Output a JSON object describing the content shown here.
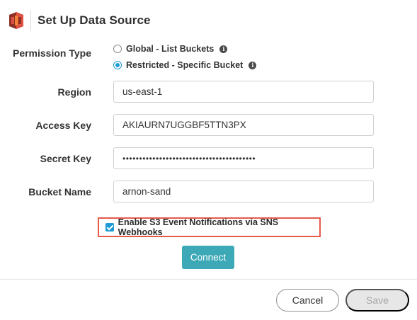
{
  "header": {
    "title": "Set Up Data Source",
    "logo_icon": "aws-s3-bucket-icon",
    "logo_colors": [
      "#e05243",
      "#8c3123"
    ]
  },
  "permission": {
    "label": "Permission Type",
    "options": [
      {
        "label": "Global - List Buckets",
        "selected": false
      },
      {
        "label": "Restricted - Specific Bucket",
        "selected": true
      }
    ],
    "info_icon": "info-icon"
  },
  "fields": {
    "region": {
      "label": "Region",
      "value": "us-east-1"
    },
    "access_key": {
      "label": "Access Key",
      "value": "AKIAURN7UGGBF5TTN3PX"
    },
    "secret_key": {
      "label": "Secret Key",
      "value": "••••••••••••••••••••••••••••••••••••••••"
    },
    "bucket_name": {
      "label": "Bucket Name",
      "value": "arnon-sand"
    }
  },
  "notifications": {
    "label": "Enable S3 Event Notifications via SNS Webhooks",
    "checked": true,
    "highlight_color": "#e55a4a"
  },
  "actions": {
    "connect_label": "Connect",
    "cancel_label": "Cancel",
    "save_label": "Save"
  },
  "colors": {
    "accent": "#1e9bd7",
    "connect": "#3da8b6",
    "save_disabled": "#e7e7e7"
  }
}
